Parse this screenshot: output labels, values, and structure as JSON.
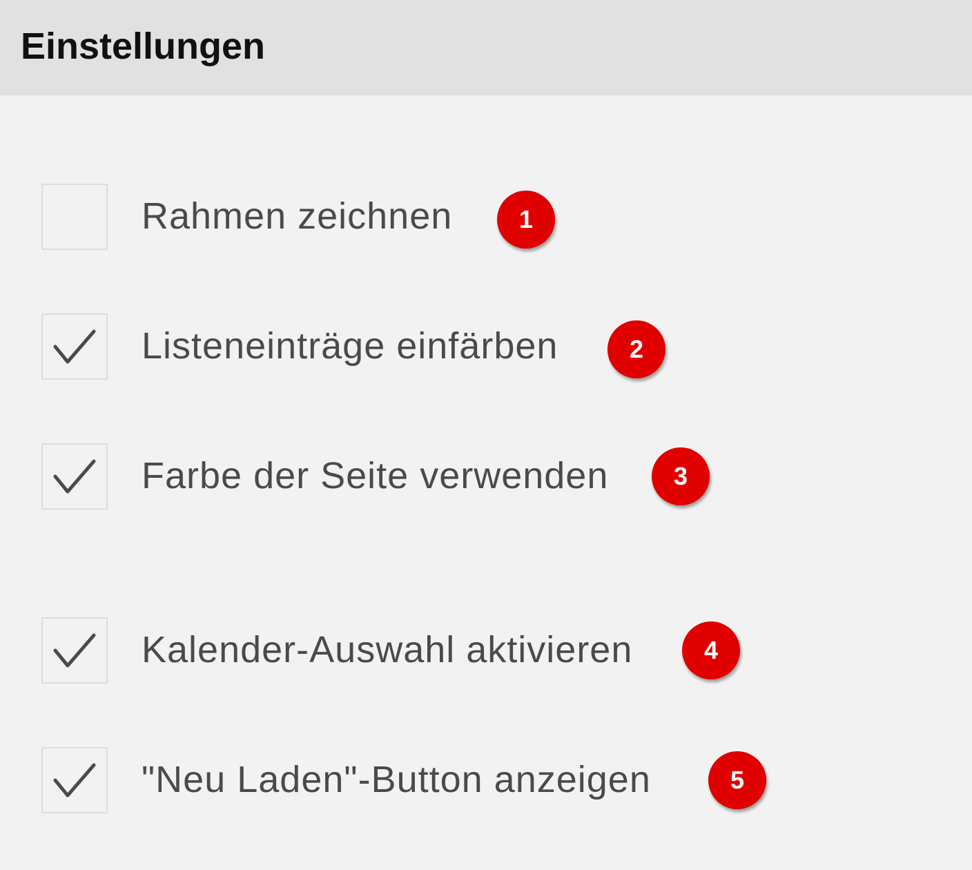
{
  "header": {
    "title": "Einstellungen"
  },
  "options": [
    {
      "label": "Rahmen zeichnen",
      "checked": false,
      "badge": "1"
    },
    {
      "label": "Listeneinträge einfärben",
      "checked": true,
      "badge": "2"
    },
    {
      "label": "Farbe der Seite verwenden",
      "checked": true,
      "badge": "3"
    },
    {
      "label": "Kalender-Auswahl aktivieren",
      "checked": true,
      "badge": "4"
    },
    {
      "label": "\"Neu Laden\"-Button anzeigen",
      "checked": true,
      "badge": "5"
    }
  ],
  "colors": {
    "header_bg": "#e1e1e1",
    "page_bg": "#f2f2f2",
    "badge": "#e00000",
    "label_text": "#4a4a4a",
    "checkmark": "#4a4a4a"
  }
}
